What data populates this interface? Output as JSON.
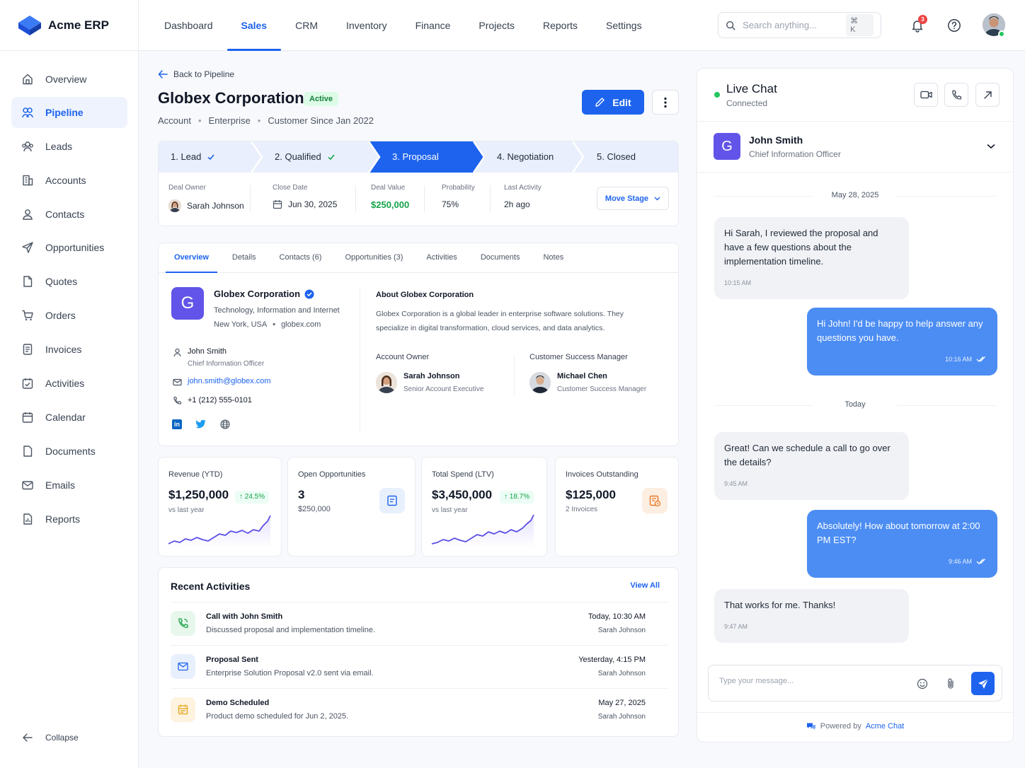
{
  "app": {
    "name": "Acme ERP"
  },
  "nav": {
    "items": [
      "Dashboard",
      "Sales",
      "CRM",
      "Inventory",
      "Finance",
      "Projects",
      "Reports",
      "Settings"
    ],
    "active_index": 1
  },
  "search": {
    "placeholder": "Search anything...",
    "shortcut": "⌘ K"
  },
  "notifications": {
    "count": "3"
  },
  "sidebar": {
    "items": [
      {
        "label": "Overview",
        "icon": "home-icon"
      },
      {
        "label": "Pipeline",
        "icon": "pipeline-icon"
      },
      {
        "label": "Leads",
        "icon": "leads-icon"
      },
      {
        "label": "Accounts",
        "icon": "building-icon"
      },
      {
        "label": "Contacts",
        "icon": "user-icon"
      },
      {
        "label": "Opportunities",
        "icon": "send-icon"
      },
      {
        "label": "Quotes",
        "icon": "file-icon"
      },
      {
        "label": "Orders",
        "icon": "cart-icon"
      },
      {
        "label": "Invoices",
        "icon": "invoice-icon"
      },
      {
        "label": "Activities",
        "icon": "calendar-check-icon"
      },
      {
        "label": "Calendar",
        "icon": "calendar-icon"
      },
      {
        "label": "Documents",
        "icon": "document-icon"
      },
      {
        "label": "Emails",
        "icon": "mail-icon"
      },
      {
        "label": "Reports",
        "icon": "report-icon"
      }
    ],
    "active_index": 1,
    "collapse_label": "Collapse"
  },
  "page": {
    "back_label": "Back to Pipeline",
    "title": "Globex Corporation",
    "status": "Active",
    "meta": [
      "Account",
      "Enterprise",
      "Customer Since Jan 2022"
    ],
    "edit_label": "Edit"
  },
  "stages": [
    {
      "label": "1. Lead",
      "state": "done"
    },
    {
      "label": "2. Qualified",
      "state": "done"
    },
    {
      "label": "3. Proposal",
      "state": "current"
    },
    {
      "label": "4. Negotiation",
      "state": "todo"
    },
    {
      "label": "5. Closed",
      "state": "todo"
    }
  ],
  "deal": {
    "owner_label": "Deal Owner",
    "owner": "Sarah Johnson",
    "close_label": "Close Date",
    "close": "Jun 30, 2025",
    "value_label": "Deal Value",
    "value": "$250,000",
    "prob_label": "Probability",
    "prob": "75%",
    "last_label": "Last Activity",
    "last": "2h ago",
    "move_label": "Move Stage"
  },
  "tabs": [
    "Overview",
    "Details",
    "Contacts (6)",
    "Opportunities (3)",
    "Activities",
    "Documents",
    "Notes"
  ],
  "company": {
    "initial": "G",
    "name": "Globex Corporation",
    "industry": "Technology, Information and Internet",
    "location": "New York, USA",
    "website": "globex.com",
    "contact_name": "John Smith",
    "contact_title": "Chief Information Officer",
    "email": "john.smith@globex.com",
    "phone": "+1 (212) 555-0101",
    "about_title": "About Globex Corporation",
    "about_text": "Globex Corporation is a global leader in enterprise software solutions. They specialize in digital transformation, cloud services, and data analytics.",
    "owner_heading": "Account Owner",
    "owner_name": "Sarah Johnson",
    "owner_role": "Senior Account Executive",
    "csm_heading": "Customer Success Manager",
    "csm_name": "Michael Chen",
    "csm_role": "Customer Success Manager"
  },
  "kpis": [
    {
      "label": "Revenue (YTD)",
      "value": "$1,250,000",
      "change": "↑ 24.5%",
      "sub": "vs last year"
    },
    {
      "label": "Open Opportunities",
      "value": "3",
      "sub": "$250,000"
    },
    {
      "label": "Total Spend (LTV)",
      "value": "$3,450,000",
      "change": "↑ 18.7%",
      "sub": "vs last year"
    },
    {
      "label": "Invoices Outstanding",
      "value": "$125,000",
      "sub": "2 Invoices"
    }
  ],
  "activities": {
    "title": "Recent Activities",
    "view_all": "View All",
    "items": [
      {
        "title": "Call with John Smith",
        "desc": "Discussed proposal and implementation timeline.",
        "time": "Today, 10:30 AM",
        "who": "Sarah Johnson",
        "icon": "phone-icon"
      },
      {
        "title": "Proposal Sent",
        "desc": "Enterprise Solution Proposal v2.0 sent via email.",
        "time": "Yesterday, 4:15 PM",
        "who": "Sarah Johnson",
        "icon": "mail-icon"
      },
      {
        "title": "Demo Scheduled",
        "desc": "Product demo scheduled for Jun 2, 2025.",
        "time": "May 27, 2025",
        "who": "Sarah Johnson",
        "icon": "calendar-icon"
      }
    ]
  },
  "chat": {
    "title": "Live Chat",
    "status": "Connected",
    "contact_initial": "G",
    "contact_name": "John Smith",
    "contact_title": "Chief Information Officer",
    "day1": "May 28, 2025",
    "day2": "Today",
    "messages": [
      {
        "dir": "in",
        "text": "Hi Sarah, I reviewed the proposal and have a few questions about the implementation timeline.",
        "time": "10:15 AM"
      },
      {
        "dir": "out",
        "text": "Hi John! I'd be happy to help answer any questions you have.",
        "time": "10:16 AM"
      },
      {
        "dir": "in",
        "text": "Great! Can we schedule a call to go over the details?",
        "time": "9:45 AM"
      },
      {
        "dir": "out",
        "text": "Absolutely! How about tomorrow at 2:00 PM EST?",
        "time": "9:46 AM"
      },
      {
        "dir": "in",
        "text": "That works for me. Thanks!",
        "time": "9:47 AM"
      }
    ],
    "input_placeholder": "Type your message...",
    "powered_prefix": "Powered by",
    "powered_brand": "Acme Chat"
  },
  "colors": {
    "accent": "#1d63ed",
    "success": "#16a34a",
    "brand_purple": "#6254e8"
  }
}
